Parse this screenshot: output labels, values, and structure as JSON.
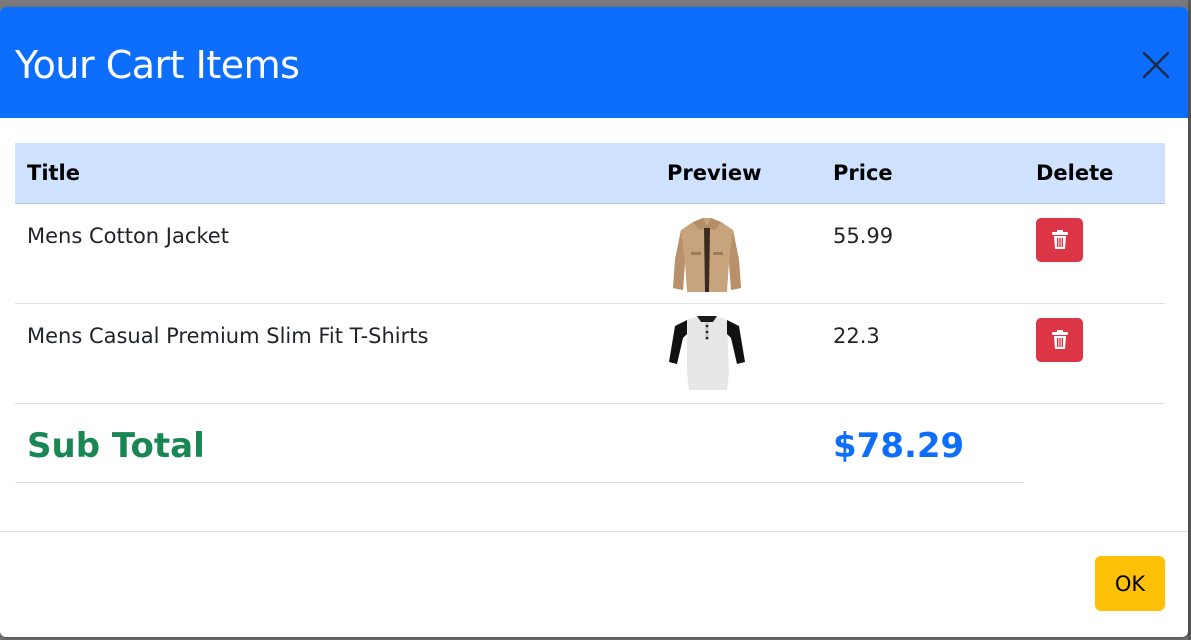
{
  "modal": {
    "title": "Your Cart Items",
    "close_icon": "close-icon",
    "ok_label": "OK"
  },
  "table": {
    "headers": {
      "title": "Title",
      "preview": "Preview",
      "price": "Price",
      "delete": "Delete"
    },
    "rows": [
      {
        "title": "Mens Cotton Jacket",
        "preview": "jacket-image",
        "price": "55.99",
        "delete_icon": "trash-icon"
      },
      {
        "title": "Mens Casual Premium Slim Fit T-Shirts",
        "preview": "tshirt-image",
        "price": "22.3",
        "delete_icon": "trash-icon"
      }
    ],
    "subtotal": {
      "label": "Sub Total",
      "value": "$78.29"
    }
  },
  "colors": {
    "header": "#0d6efd",
    "table_head": "#cfe2ff",
    "delete_button": "#dc3545",
    "subtotal_label": "#198754",
    "subtotal_value": "#0d6efd",
    "ok_button": "#ffc107"
  }
}
